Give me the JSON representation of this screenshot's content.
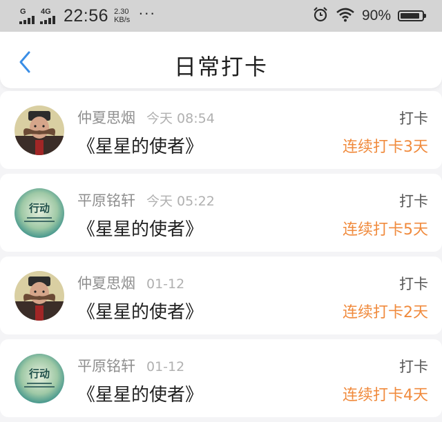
{
  "status_bar": {
    "sim1": "G",
    "sim2": "4G",
    "time": "22:56",
    "speed_value": "2.30",
    "speed_unit": "KB/s",
    "more": "···",
    "battery": "90%",
    "battery_level": 0.9,
    "icons": [
      "alarm-icon",
      "wifi-icon",
      "battery-icon"
    ]
  },
  "nav": {
    "title": "日常打卡",
    "back_icon": "chevron-left-icon",
    "accent": "#3a8ee6"
  },
  "colors": {
    "streak": "#f08a3c",
    "name": "#8f8f8f"
  },
  "feed": [
    {
      "name": "仲夏思烟",
      "time": "今天 08:54",
      "book": "《星星的使者》",
      "action": "打卡",
      "streak": "连续打卡3天",
      "avatar": "mustache-man"
    },
    {
      "name": "平原铭轩",
      "time": "今天 05:22",
      "book": "《星星的使者》",
      "action": "打卡",
      "streak": "连续打卡5天",
      "avatar": "action-badge",
      "avatar_text": "行动"
    },
    {
      "name": "仲夏思烟",
      "time": "01-12",
      "book": "《星星的使者》",
      "action": "打卡",
      "streak": "连续打卡2天",
      "avatar": "mustache-man"
    },
    {
      "name": "平原铭轩",
      "time": "01-12",
      "book": "《星星的使者》",
      "action": "打卡",
      "streak": "连续打卡4天",
      "avatar": "action-badge",
      "avatar_text": "行动"
    }
  ]
}
